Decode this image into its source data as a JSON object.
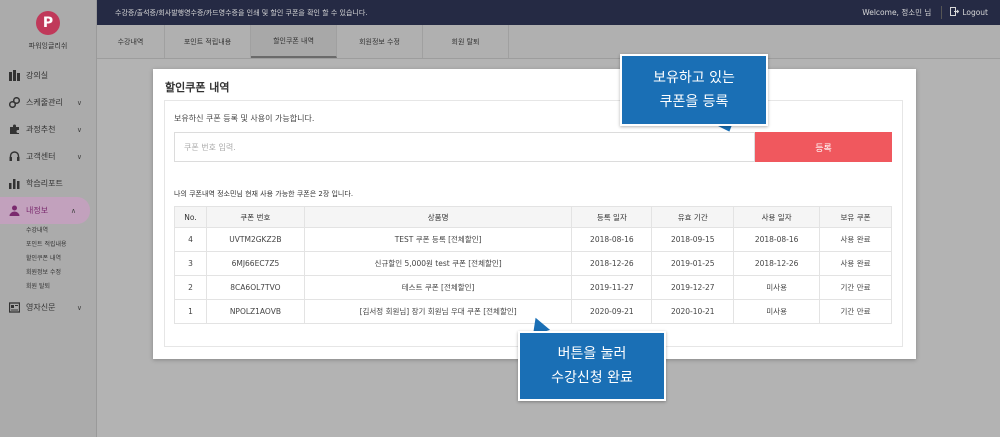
{
  "sidebar": {
    "logo_letter": "P",
    "logo_text": "파워잉글리쉬",
    "items": [
      {
        "label": "강의실",
        "icon": "books-icon",
        "chevron": ""
      },
      {
        "label": "스케줄관리",
        "icon": "link-icon",
        "chevron": "∨"
      },
      {
        "label": "과정추천",
        "icon": "puzzle-icon",
        "chevron": "∨"
      },
      {
        "label": "고객센터",
        "icon": "headset-icon",
        "chevron": "∨"
      },
      {
        "label": "학습리포트",
        "icon": "bar-chart-icon",
        "chevron": ""
      },
      {
        "label": "내정보",
        "icon": "user-icon",
        "chevron": "∧"
      }
    ],
    "submenu": [
      "수강내역",
      "포인트 적립내용",
      "할인쿠폰 내역",
      "회원정보 수정",
      "회원 탈퇴"
    ],
    "last_item": {
      "label": "영자신문",
      "icon": "newspaper-icon",
      "chevron": "∨"
    }
  },
  "topbar": {
    "notice": "수강증/출석증/회사발행영수증/카드영수증을 인쇄 및 할인 쿠폰을 확인 할 수 있습니다.",
    "welcome": "Welcome, 정소민 님",
    "logout": "Logout"
  },
  "tabs": [
    "수강내역",
    "포인트 적립내용",
    "할인쿠폰 내역",
    "회원정보 수정",
    "회원 탈퇴"
  ],
  "active_tab_index": 2,
  "panel": {
    "title": "할인쿠폰 내역",
    "register_desc": "보유하신 쿠폰 등록 및 사용이 가능합니다.",
    "input_placeholder": "쿠폰 번호 입력.",
    "register_button": "등록",
    "list_desc": "나의 쿠폰내역 정소민님 현재 사용 가능한 쿠폰은 2장 입니다."
  },
  "table": {
    "headers": [
      "No.",
      "쿠폰 번호",
      "상품명",
      "등록 일자",
      "유효 기간",
      "사용 일자",
      "보유 쿠폰"
    ],
    "rows": [
      [
        "4",
        "UVTM2GKZ2B",
        "TEST 쿠폰 등록 [전체할인]",
        "2018-08-16",
        "2018-09-15",
        "2018-08-16",
        "사용 완료"
      ],
      [
        "3",
        "6MJ66EC7Z5",
        "신규할인 5,000원 test 쿠폰 [전체할인]",
        "2018-12-26",
        "2019-01-25",
        "2018-12-26",
        "사용 완료"
      ],
      [
        "2",
        "8CA6OL7TVO",
        "테스트 쿠폰 [전체할인]",
        "2019-11-27",
        "2019-12-27",
        "미사용",
        "기간 만료"
      ],
      [
        "1",
        "NPOLZ1AOVB",
        "[김서정 회원님] 장기 회원님 우대 쿠폰 [전체할인]",
        "2020-09-21",
        "2020-10-21",
        "미사용",
        "기간 만료"
      ]
    ]
  },
  "callouts": [
    {
      "line1": "보유하고 있는",
      "line2": "쿠폰을 등록"
    },
    {
      "line1": "버튼을 눌러",
      "line2": "수강신청 완료"
    }
  ],
  "colors": {
    "topbar_bg": "#252a44",
    "register_button": "#f0585e",
    "callout_bg": "#1a6fb5",
    "logo": "#c0395a",
    "active_menu": "#7a2a6e"
  }
}
